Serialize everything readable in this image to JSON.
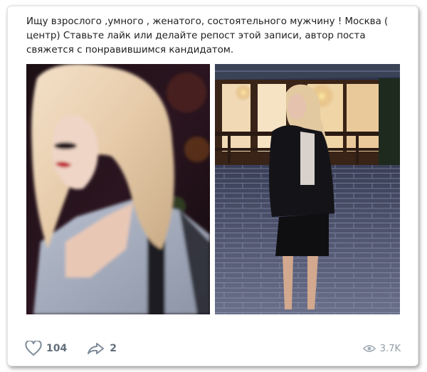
{
  "post": {
    "text": "Ищу взрослого ,умного , женатого, состоятельного мужчину ! Москва ( центр) Ставьте лайк или делайте репост этой записи, автор поста свяжется с понравившимся кандидатом."
  },
  "photos": [
    {
      "subject": "blonde woman in plaid jacket, blurred"
    },
    {
      "subject": "blonde woman in leather jacket and black skirt on brick patio at night"
    }
  ],
  "actions": {
    "likes": "104",
    "reposts": "2",
    "views": "3.7K"
  },
  "icons": {
    "like": "heart-icon",
    "repost": "share-arrow-icon",
    "views": "eye-icon"
  },
  "colors": {
    "icon": "#7f8b99",
    "count": "#626d7a"
  }
}
